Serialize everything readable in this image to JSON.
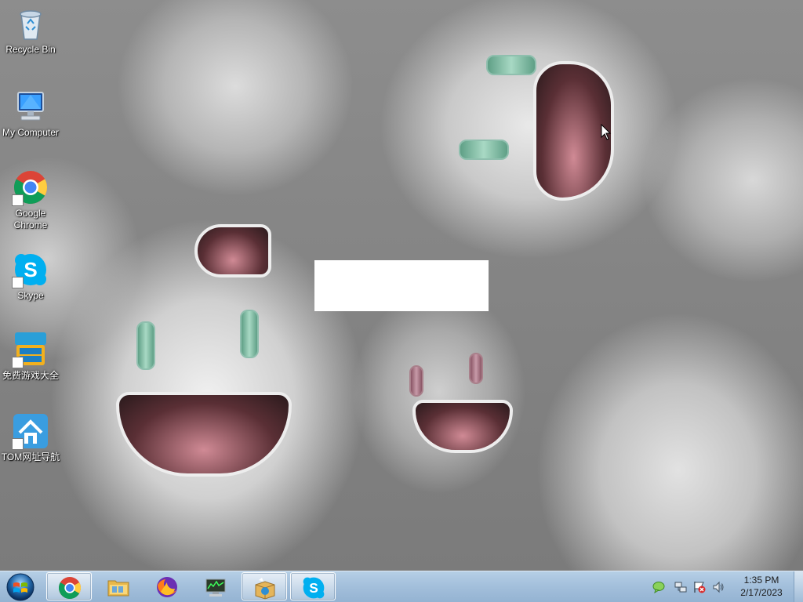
{
  "desktop": {
    "icons": [
      {
        "label": "Recycle Bin",
        "icon": "recycle-bin-icon"
      },
      {
        "label": "My Computer",
        "icon": "computer-icon"
      },
      {
        "label": "Google Chrome",
        "icon": "chrome-icon"
      },
      {
        "label": "Skype",
        "icon": "skype-icon"
      },
      {
        "label": "免费游戏大全",
        "icon": "tom-games-icon"
      },
      {
        "label": "TOM网址导航",
        "icon": "tom-home-icon"
      }
    ]
  },
  "taskbar": {
    "start": {
      "icon": "windows-start-icon"
    },
    "pinned": [
      {
        "name": "Google Chrome",
        "icon": "chrome-icon",
        "active": true
      },
      {
        "name": "Windows Explorer",
        "icon": "folder-icon",
        "active": false
      },
      {
        "name": "Firefox",
        "icon": "firefox-icon",
        "active": false
      },
      {
        "name": "Task Manager",
        "icon": "monitor-icon",
        "active": false
      },
      {
        "name": "Installer",
        "icon": "package-icon",
        "active": true
      },
      {
        "name": "Skype",
        "icon": "skype-icon",
        "active": true
      }
    ],
    "tray": {
      "icons": [
        "chat-bubble-icon",
        "network-icon",
        "action-center-icon",
        "volume-icon"
      ],
      "time": "1:35 PM",
      "date": "2/17/2023"
    }
  },
  "colors": {
    "taskbar_top": "#b6cfe6",
    "taskbar_bottom": "#94b3d2",
    "label_text": "#ffffff"
  }
}
